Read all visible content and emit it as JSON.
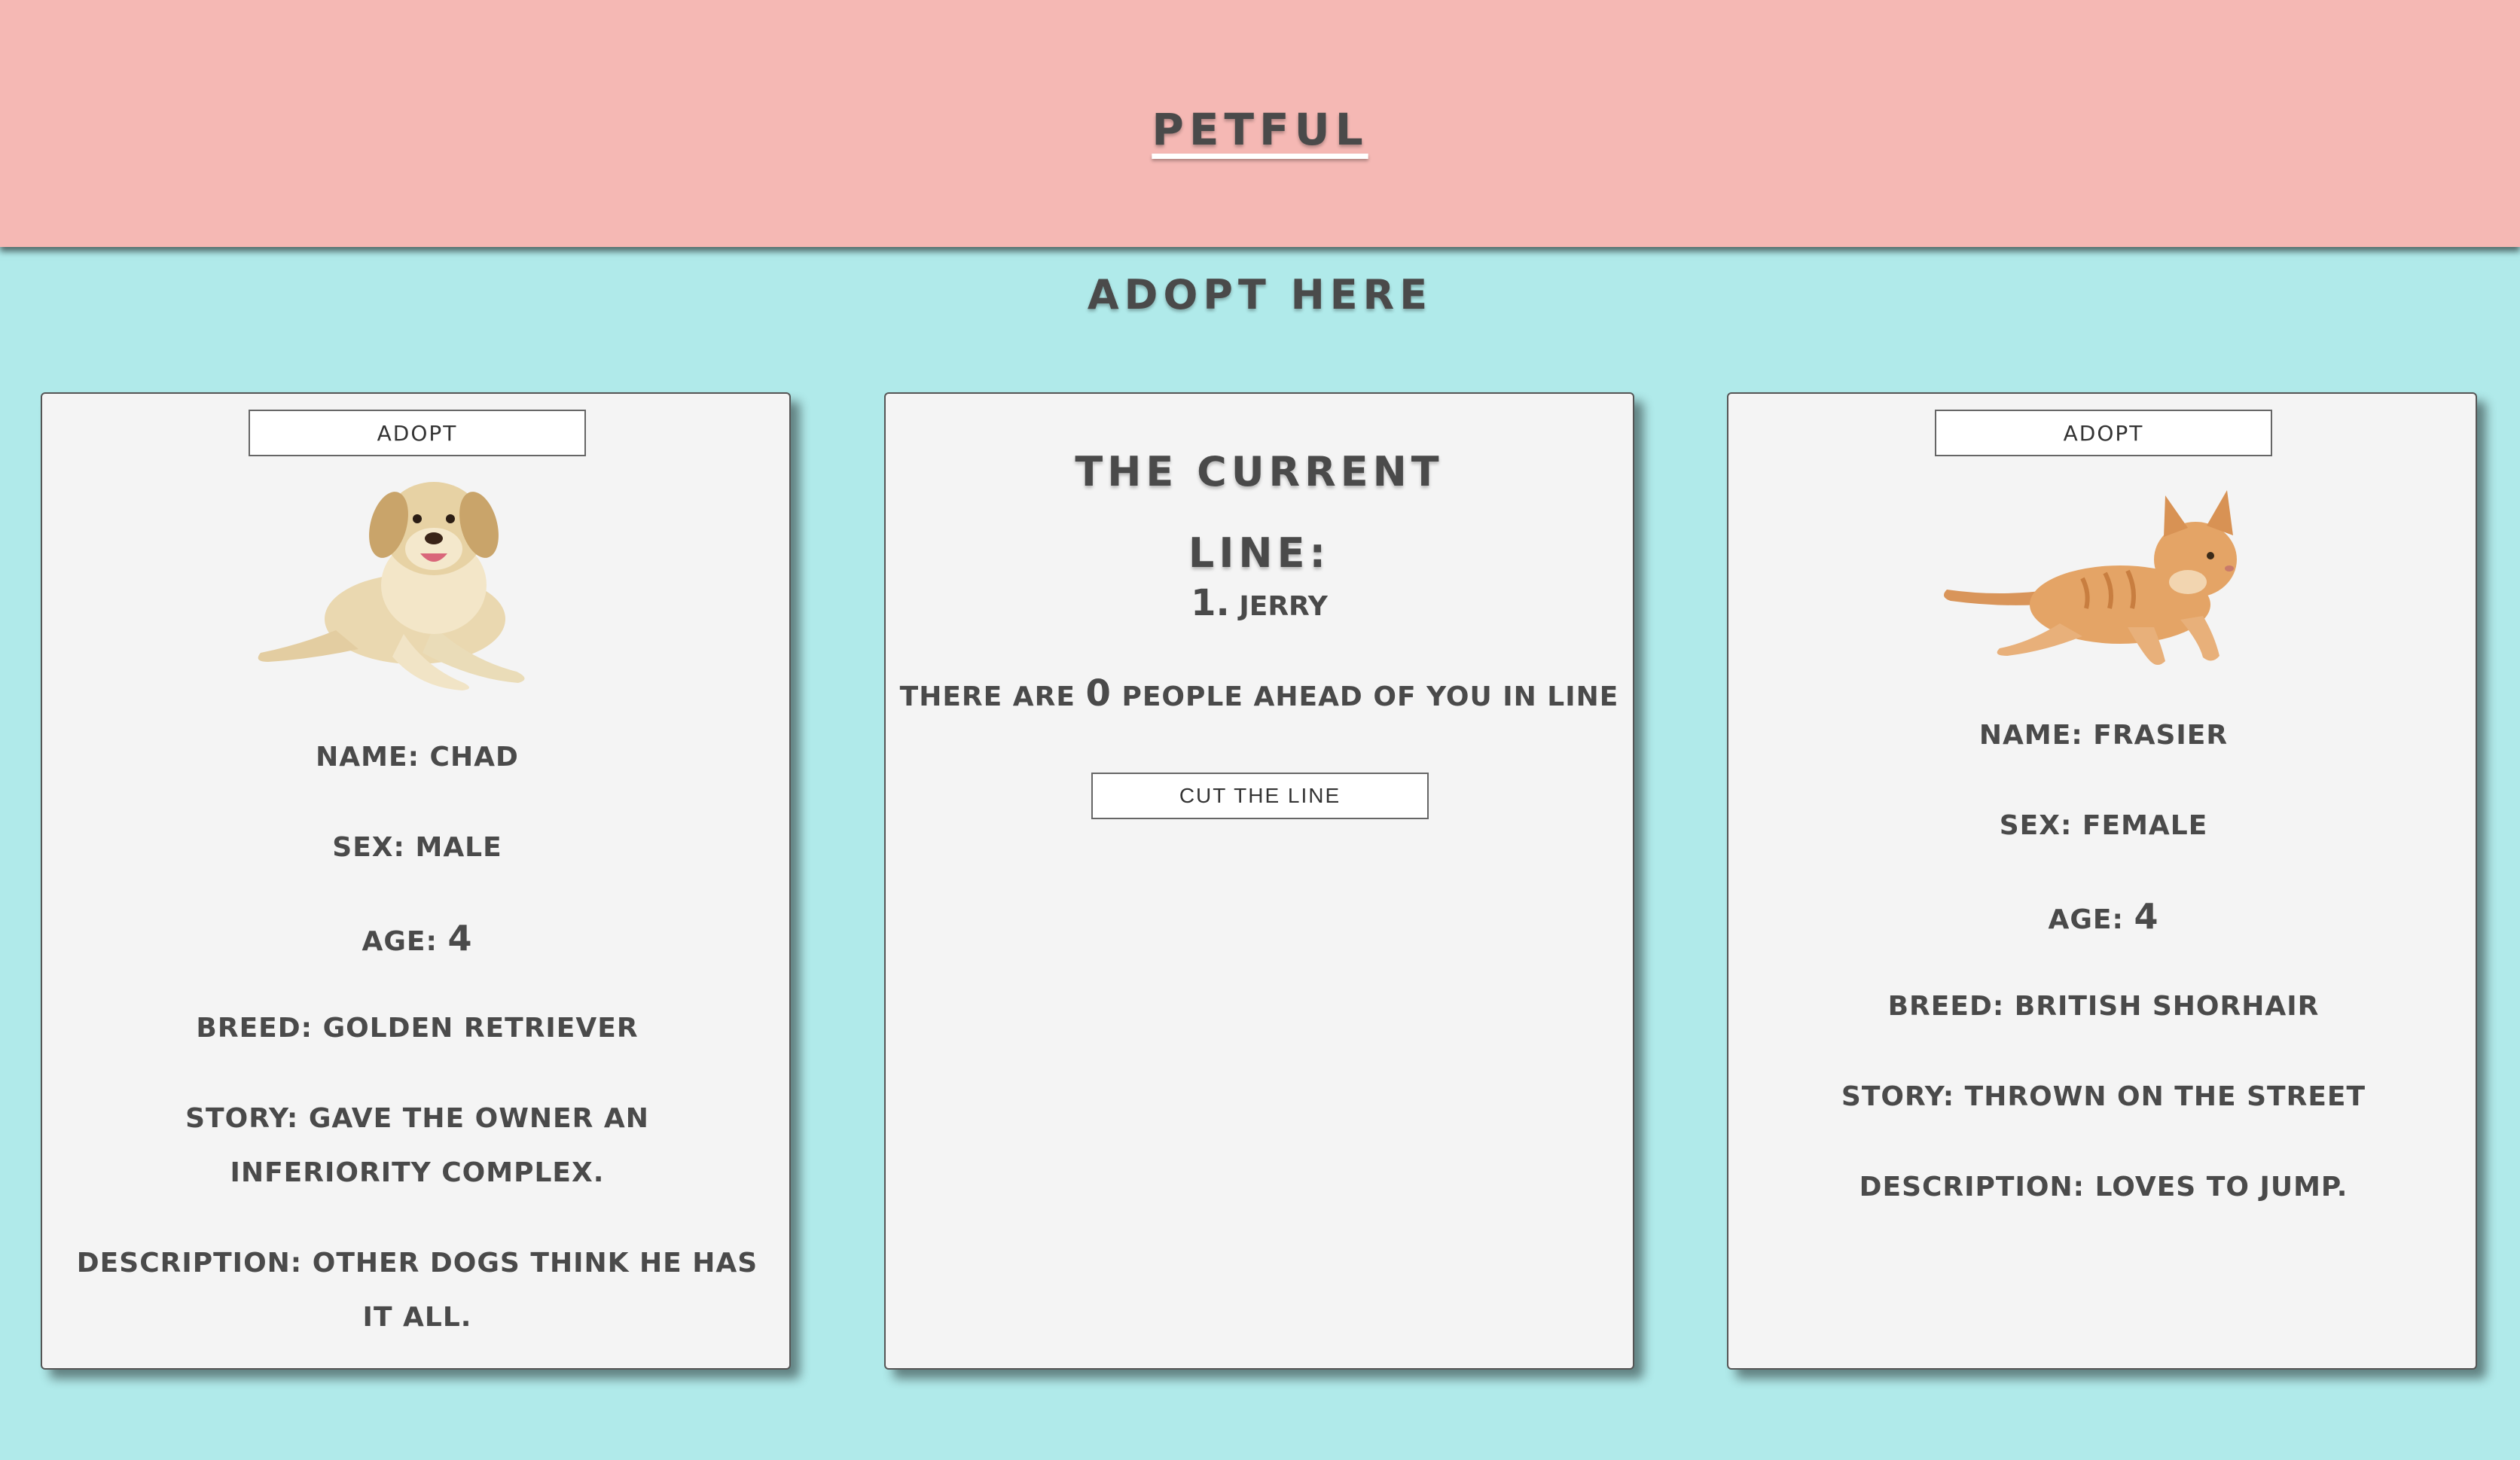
{
  "header": {
    "logo": "PETFUL"
  },
  "page": {
    "subtitle": "ADOPT HERE"
  },
  "dog": {
    "adopt_label": "ADOPT",
    "name_label": "NAME:",
    "name": "CHAD",
    "sex_label": "SEX:",
    "sex": "MALE",
    "age_label": "AGE:",
    "age": "4",
    "breed_label": "BREED:",
    "breed": "GOLDEN RETRIEVER",
    "story_label": "STORY:",
    "story": "GAVE THE OWNER AN INFERIORITY COMPLEX.",
    "description_label": "DESCRIPTION:",
    "description": "OTHER DOGS THINK HE HAS IT ALL."
  },
  "queue": {
    "title_line1": "THE CURRENT",
    "title_line2": "LINE:",
    "items": [
      {
        "number": "1.",
        "name": "JERRY"
      }
    ],
    "ahead_prefix": "THERE ARE",
    "ahead_count": "0",
    "ahead_suffix": "PEOPLE AHEAD OF YOU IN LINE",
    "cut_label": "CUT THE LINE"
  },
  "cat": {
    "adopt_label": "ADOPT",
    "name_label": "NAME:",
    "name": "FRASIER",
    "sex_label": "SEX:",
    "sex": "FEMALE",
    "age_label": "AGE:",
    "age": "4",
    "breed_label": "BREED:",
    "breed": "BRITISH SHORHAIR",
    "story_label": "STORY:",
    "story": "THROWN ON THE STREET",
    "description_label": "DESCRIPTION:",
    "description": "LOVES TO JUMP."
  }
}
